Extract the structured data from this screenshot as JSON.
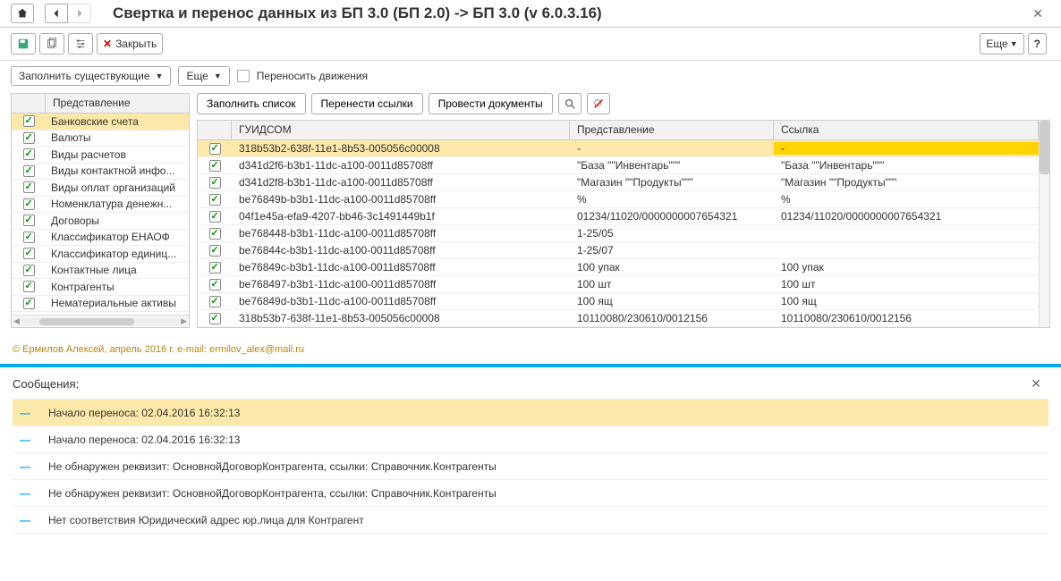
{
  "header": {
    "title": "Свертка и перенос данных из БП 3.0 (БП 2.0) -> БП 3.0 (v 6.0.3.16)"
  },
  "toolbar": {
    "close_label": "Закрыть",
    "more_label": "Еще"
  },
  "subtoolbar": {
    "fill_existing": "Заполнить существующие",
    "more": "Еще",
    "transfer_movements": "Переносить движения"
  },
  "left": {
    "header": "Представление",
    "items": [
      {
        "label": "Банковские счета",
        "checked": true,
        "selected": true
      },
      {
        "label": "Валюты",
        "checked": true
      },
      {
        "label": "Виды расчетов",
        "checked": true
      },
      {
        "label": "Виды контактной инфо...",
        "checked": true
      },
      {
        "label": "Виды оплат организаций",
        "checked": true
      },
      {
        "label": "Номенклатура денежн...",
        "checked": true
      },
      {
        "label": "Договоры",
        "checked": true
      },
      {
        "label": "Классификатор ЕНАОФ",
        "checked": true
      },
      {
        "label": "Классификатор единиц...",
        "checked": true
      },
      {
        "label": "Контактные лица",
        "checked": true
      },
      {
        "label": "Контрагенты",
        "checked": true
      },
      {
        "label": "Нематериальные активы",
        "checked": true
      }
    ]
  },
  "right": {
    "actions": {
      "fill_list": "Заполнить список",
      "transfer_links": "Перенести ссылки",
      "process_docs": "Провести документы"
    },
    "columns": {
      "guid": "ГУИДСОМ",
      "repr": "Представление",
      "link": "Ссылка"
    },
    "rows": [
      {
        "guid": "318b53b2-638f-11e1-8b53-005056c00008",
        "repr": "-",
        "link": "-",
        "highlight": true
      },
      {
        "guid": "d341d2f6-b3b1-11dc-a100-0011d85708ff",
        "repr": "\"База \"\"Инвентарь\"\"\"",
        "link": "\"База \"\"Инвентарь\"\"\""
      },
      {
        "guid": "d341d2f8-b3b1-11dc-a100-0011d85708ff",
        "repr": "\"Магазин \"\"Продукты\"\"\"",
        "link": "\"Магазин \"\"Продукты\"\"\""
      },
      {
        "guid": "be76849b-b3b1-11dc-a100-0011d85708ff",
        "repr": "%",
        "link": "%"
      },
      {
        "guid": "04f1e45a-efa9-4207-bb46-3c1491449b1f",
        "repr": "01234/11020/0000000007654321",
        "link": "01234/11020/0000000007654321"
      },
      {
        "guid": "be768448-b3b1-11dc-a100-0011d85708ff",
        "repr": "1-25/05",
        "link": ""
      },
      {
        "guid": "be76844c-b3b1-11dc-a100-0011d85708ff",
        "repr": "1-25/07",
        "link": ""
      },
      {
        "guid": "be76849c-b3b1-11dc-a100-0011d85708ff",
        "repr": "100 упак",
        "link": "100 упак"
      },
      {
        "guid": "be768497-b3b1-11dc-a100-0011d85708ff",
        "repr": "100 шт",
        "link": "100 шт"
      },
      {
        "guid": "be76849d-b3b1-11dc-a100-0011d85708ff",
        "repr": "100 ящ",
        "link": "100 ящ"
      },
      {
        "guid": "318b53b7-638f-11e1-8b53-005056c00008",
        "repr": "10110080/230610/0012156",
        "link": "10110080/230610/0012156"
      }
    ]
  },
  "footer": {
    "credit": "© Ермилов Алексей, апрель 2016 г. e-mail: ermilov_alex@mail.ru"
  },
  "messages": {
    "title": "Сообщения:",
    "items": [
      {
        "text": "Начало переноса: 02.04.2016 16:32:13",
        "highlight": true
      },
      {
        "text": "Начало переноса: 02.04.2016 16:32:13"
      },
      {
        "text": "Не обнаружен реквизит: ОсновнойДоговорКонтрагента, ссылки: Справочник.Контрагенты"
      },
      {
        "text": "Не обнаружен реквизит: ОсновнойДоговорКонтрагента, ссылки: Справочник.Контрагенты"
      },
      {
        "text": "Нет соответствия Юридический адрес юр.лица для Контрагент"
      }
    ]
  }
}
